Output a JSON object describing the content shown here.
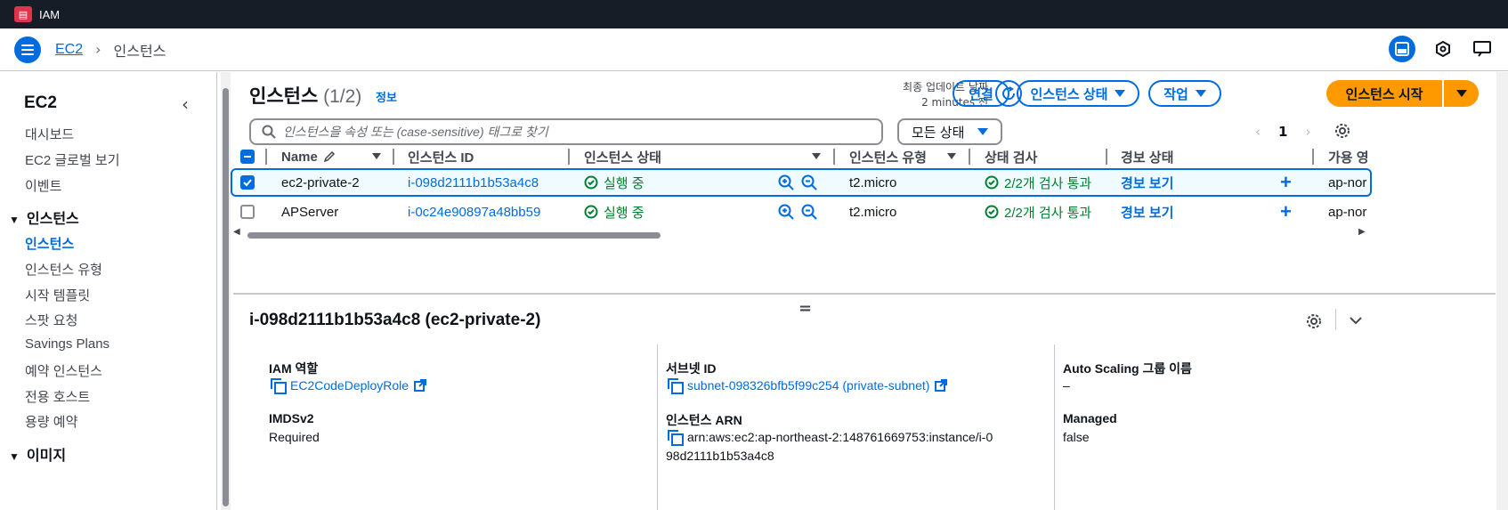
{
  "topbar": {
    "logo_text": "IAM",
    "title": "IAM"
  },
  "nav": {
    "breadcrumb_root": "EC2",
    "breadcrumb_current": "인스턴스"
  },
  "sidebar": {
    "title": "EC2",
    "items_top": [
      "대시보드",
      "EC2 글로벌 보기",
      "이벤트"
    ],
    "section_instances": "인스턴스",
    "items_instances": [
      "인스턴스",
      "인스턴스 유형",
      "시작 템플릿",
      "스팟 요청",
      "Savings Plans",
      "예약 인스턴스",
      "전용 호스트",
      "용량 예약"
    ],
    "section_images": "이미지"
  },
  "header": {
    "title": "인스턴스",
    "count": "(1/2)",
    "info": "정보",
    "last_updated_label": "최종 업데이트 날짜",
    "last_updated_value": "2 minutes 전",
    "connect_label": "연결",
    "instance_state_label": "인스턴스 상태",
    "actions_label": "작업",
    "launch_label": "인스턴스 시작"
  },
  "search": {
    "placeholder": "인스턴스을 속성 또는 (case-sensitive) 태그로 찾기"
  },
  "filter": {
    "state_select": "모든 상태"
  },
  "pager": {
    "page": "1"
  },
  "table": {
    "columns": [
      "Name",
      "인스턴스 ID",
      "인스턴스 상태",
      "인스턴스 유형",
      "상태 검사",
      "경보 상태",
      "가용 영"
    ],
    "rows": [
      {
        "name": "ec2-private-2",
        "id": "i-098d2111b1b53a4c8",
        "state": "실행 중",
        "type": "t2.micro",
        "check": "2/2개 검사 통과",
        "alarm": "경보 보기",
        "az": "ap-nor",
        "selected": true
      },
      {
        "name": "APServer",
        "id": "i-0c24e90897a48bb59",
        "state": "실행 중",
        "type": "t2.micro",
        "check": "2/2개 검사 통과",
        "alarm": "경보 보기",
        "az": "ap-nor",
        "selected": false
      }
    ]
  },
  "details": {
    "title": "i-098d2111b1b53a4c8 (ec2-private-2)",
    "iam_role_label": "IAM 역할",
    "iam_role_value": "EC2CodeDeployRole",
    "subnet_label": "서브넷 ID",
    "subnet_value": "subnet-098326bfb5f99c254 (private-subnet)",
    "asg_label": "Auto Scaling 그룹 이름",
    "asg_value": "–",
    "imds_label": "IMDSv2",
    "imds_value": "Required",
    "arn_label": "인스턴스 ARN",
    "arn_line1": "arn:aws:ec2:ap-northeast-2:148761669753:instance/i-0",
    "arn_line2": "98d2111b1b53a4c8",
    "managed_label": "Managed",
    "managed_value": "false"
  },
  "colors": {
    "accent": "#006ce0",
    "primary": "#ff9900",
    "success": "#00802f",
    "topbar": "#161d26"
  }
}
